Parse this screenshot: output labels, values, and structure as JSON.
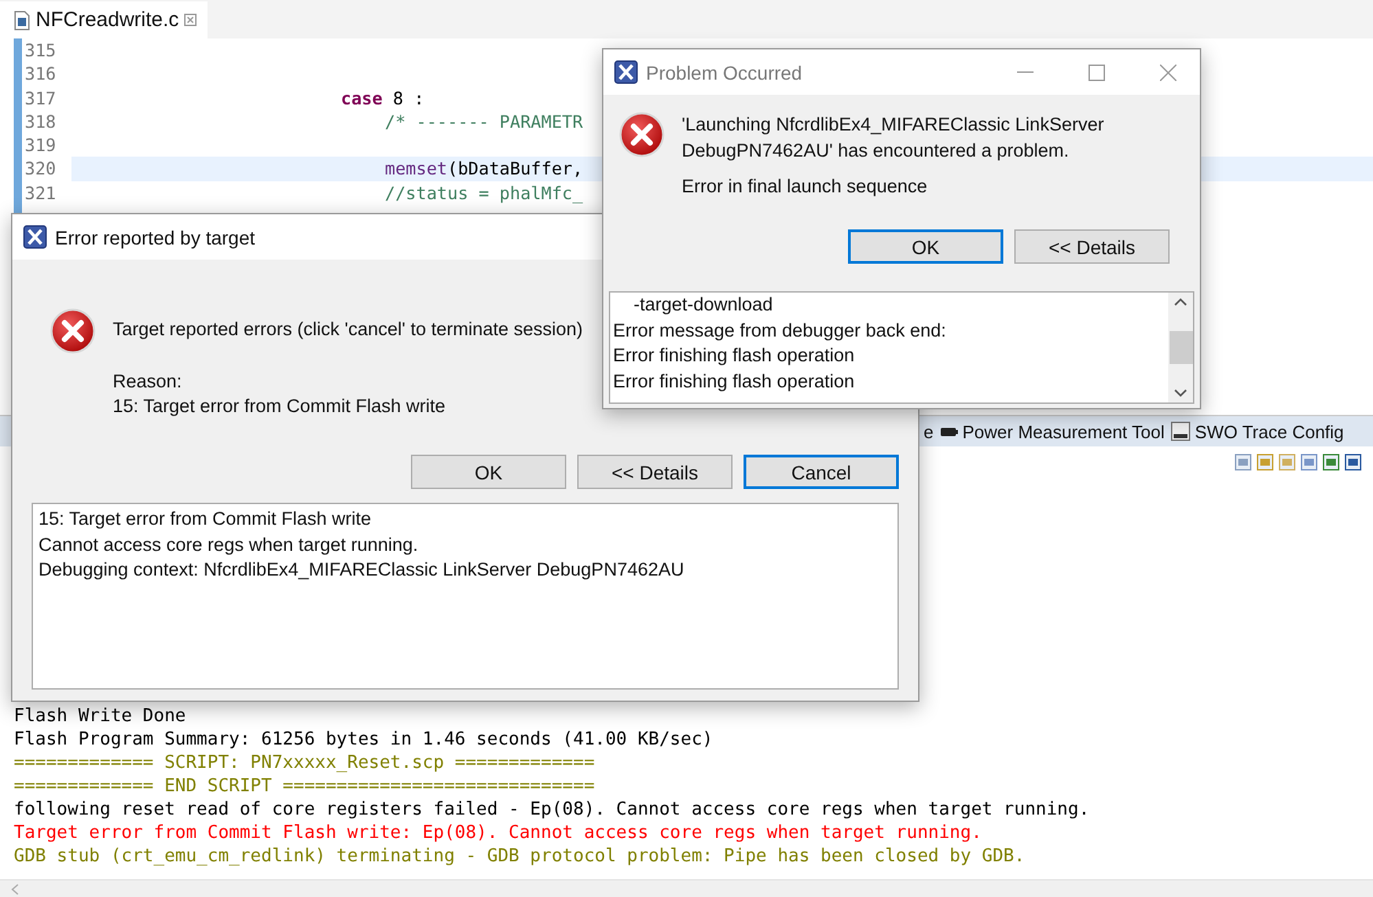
{
  "editor": {
    "tab": {
      "title": "NFCreadwrite.c",
      "selected": true
    },
    "lines": [
      {
        "number": "315",
        "current": false,
        "kind": "blank"
      },
      {
        "number": "316",
        "current": false,
        "kind": "blank"
      },
      {
        "number": "317",
        "current": false,
        "kind": "label",
        "tokens": [
          {
            "text": "case",
            "kind": "keyword"
          },
          {
            "text": " 8 :",
            "kind": "plain"
          }
        ]
      },
      {
        "number": "318",
        "current": false,
        "kind": "body",
        "tokens": [
          {
            "text": "/* ------- PARAMETR",
            "kind": "comment"
          }
        ]
      },
      {
        "number": "319",
        "current": false,
        "kind": "blank"
      },
      {
        "number": "320",
        "current": true,
        "kind": "body",
        "tokens": [
          {
            "text": "memset",
            "kind": "function"
          },
          {
            "text": "(bDataBuffer,",
            "kind": "plain"
          }
        ]
      },
      {
        "number": "321",
        "current": false,
        "kind": "body",
        "tokens": [
          {
            "text": "//status = phalMfc_",
            "kind": "comment"
          }
        ]
      }
    ]
  },
  "console": {
    "tabs": [
      {
        "label": "e"
      },
      {
        "label": "Power Measurement Tool"
      },
      {
        "label": "SWO Trace Config"
      }
    ],
    "lines": [
      {
        "text": "Flash Write Done",
        "kind": "normal"
      },
      {
        "text": "Flash Program Summary: 61256 bytes in 1.46 seconds (41.00 KB/sec)",
        "kind": "normal"
      },
      {
        "text": "============= SCRIPT: PN7xxxxx_Reset.scp =============",
        "kind": "script"
      },
      {
        "text": "============= END SCRIPT =============================",
        "kind": "script"
      },
      {
        "text": "following reset read of core registers failed - Ep(08). Cannot access core regs when target running.",
        "kind": "normal"
      },
      {
        "text": "Target error from Commit Flash write: Ep(08). Cannot access core regs when target running.",
        "kind": "error"
      },
      {
        "text": "GDB stub (crt_emu_cm_redlink) terminating - GDB protocol problem: Pipe has been closed by GDB.",
        "kind": "script"
      }
    ]
  },
  "error_dialog": {
    "title": "Error reported by target",
    "message": "Target reported errors (click 'cancel' to terminate session)",
    "reason_label": "Reason:",
    "reason": "15: Target error from Commit Flash write",
    "buttons": [
      {
        "label": "OK",
        "default": false
      },
      {
        "label": "<< Details",
        "default": false
      },
      {
        "label": "Cancel",
        "default": true
      }
    ],
    "details": [
      "15: Target error from Commit Flash write",
      "Cannot access core regs when target running.",
      "Debugging context: NfcrdlibEx4_MIFAREClassic LinkServer DebugPN7462AU"
    ]
  },
  "problem_dialog": {
    "title": "Problem Occurred",
    "message": "'Launching NfcrdlibEx4_MIFAREClassic LinkServer DebugPN7462AU' has encountered a problem.",
    "submessage": "Error in final launch sequence",
    "buttons": [
      {
        "label": "OK",
        "default": true
      },
      {
        "label": "<< Details",
        "default": false
      }
    ],
    "details": [
      "    -target-download",
      "Error message from debugger back end:",
      "Error finishing flash operation",
      "Error finishing flash operation"
    ]
  }
}
